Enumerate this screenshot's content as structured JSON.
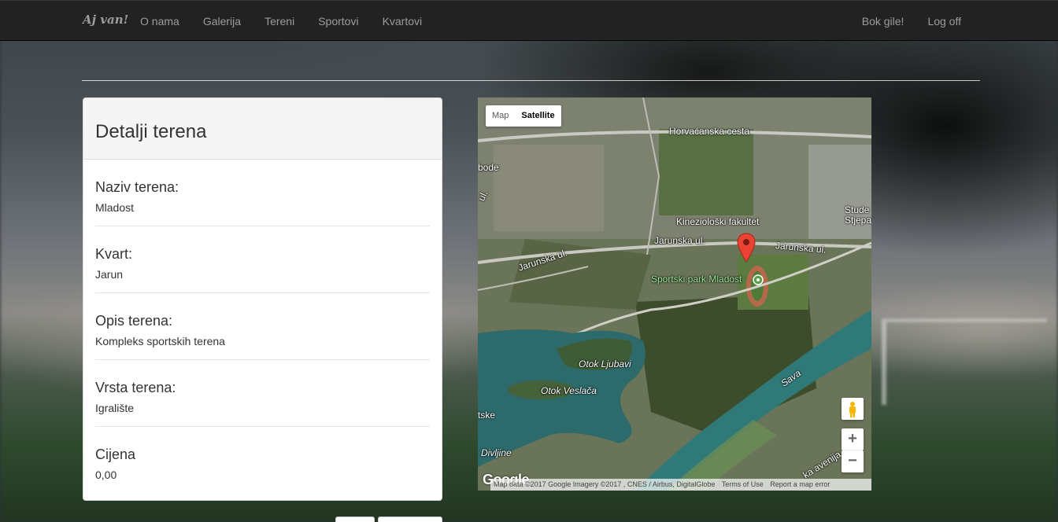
{
  "navbar": {
    "brand": "Aj van!",
    "links": [
      "O nama",
      "Galerija",
      "Tereni",
      "Sportovi",
      "Kvartovi"
    ],
    "greeting": "Bok gile!",
    "logoff": "Log off"
  },
  "panel": {
    "title": "Detalji terena",
    "fields": [
      {
        "label": "Naziv terena:",
        "value": "Mladost"
      },
      {
        "label": "Kvart:",
        "value": "Jarun"
      },
      {
        "label": "Opis terena:",
        "value": "Kompleks sportskih terena"
      },
      {
        "label": "Vrsta terena:",
        "value": "Igralište"
      },
      {
        "label": "Cijena",
        "value": "0,00"
      }
    ]
  },
  "map": {
    "type_map": "Map",
    "type_satellite": "Satellite",
    "zoom_in": "+",
    "zoom_out": "−",
    "labels": {
      "horvacanska": "Horvaćanska cesta",
      "kinezioloski": "Kineziološki fakultet",
      "jarunska_right": "Jarunska ul.",
      "jarunska_mid": "Jarunska ul.",
      "jarunska_left": "Jarunska ul.",
      "sportski_park": "Sportski park Mladost",
      "otok_ljubavi": "Otok Ljubavi",
      "otok_veslaca": "Otok Veslača",
      "sava": "Sava",
      "divljine": "Divljine",
      "student": "Stude",
      "stjepan": "Stjepa",
      "bode": "bode",
      "ul_left": "ul.",
      "tske": "tske",
      "avenija": "ka avenija"
    },
    "google": "Google",
    "attribution": {
      "data": "Map data ©2017 Google Imagery ©2017 , CNES / Airbus, DigitalGlobe",
      "terms": "Terms of Use",
      "report": "Report a map error"
    }
  }
}
